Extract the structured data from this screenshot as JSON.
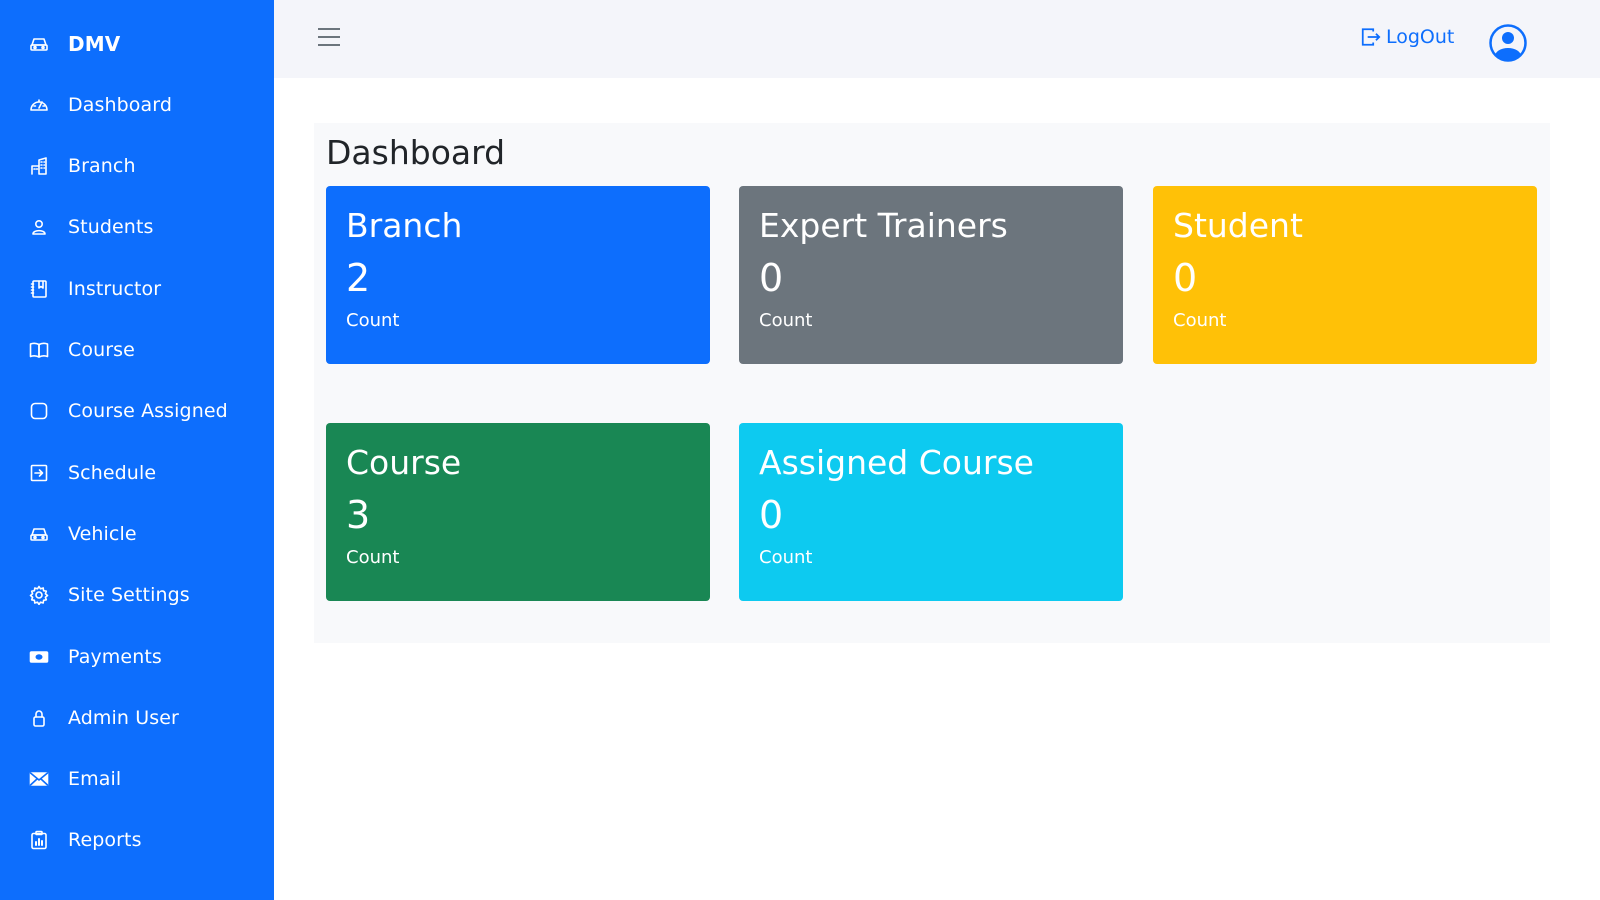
{
  "sidebar": {
    "brand": {
      "label": "DMV",
      "icon": "car-icon"
    },
    "items": [
      {
        "label": "Dashboard",
        "icon": "speedometer-icon"
      },
      {
        "label": "Branch",
        "icon": "building-icon"
      },
      {
        "label": "Students",
        "icon": "person-icon"
      },
      {
        "label": "Instructor",
        "icon": "journal-bookmark-icon"
      },
      {
        "label": "Course",
        "icon": "book-icon"
      },
      {
        "label": "Course Assigned",
        "icon": "square-icon"
      },
      {
        "label": "Schedule",
        "icon": "box-arrow-in-right-icon"
      },
      {
        "label": "Vehicle",
        "icon": "car-icon"
      },
      {
        "label": "Site Settings",
        "icon": "gear-icon"
      },
      {
        "label": "Payments",
        "icon": "cash-icon"
      },
      {
        "label": "Admin User",
        "icon": "lock-icon"
      },
      {
        "label": "Email",
        "icon": "envelope-icon"
      },
      {
        "label": "Reports",
        "icon": "clipboard-data-icon"
      }
    ]
  },
  "topbar": {
    "menu_icon": "hamburger-icon",
    "logout_label": "LogOut",
    "logout_icon": "box-arrow-right-icon",
    "avatar_icon": "person-circle-icon"
  },
  "main": {
    "page_title": "Dashboard",
    "cards": [
      {
        "title": "Branch",
        "value": "2",
        "sub": "Count",
        "color": "#0d6efd"
      },
      {
        "title": "Expert Trainers",
        "value": "0",
        "sub": "Count",
        "color": "#6c757d"
      },
      {
        "title": "Student",
        "value": "0",
        "sub": "Count",
        "color": "#ffc107"
      },
      {
        "title": "Course",
        "value": "3",
        "sub": "Count",
        "color": "#198754"
      },
      {
        "title": "Assigned Course",
        "value": "0",
        "sub": "Count",
        "color": "#0dcaf0"
      }
    ]
  },
  "colors": {
    "sidebar_bg": "#0d6efd",
    "topbar_bg": "#f4f5fa",
    "accent": "#0d6efd"
  }
}
